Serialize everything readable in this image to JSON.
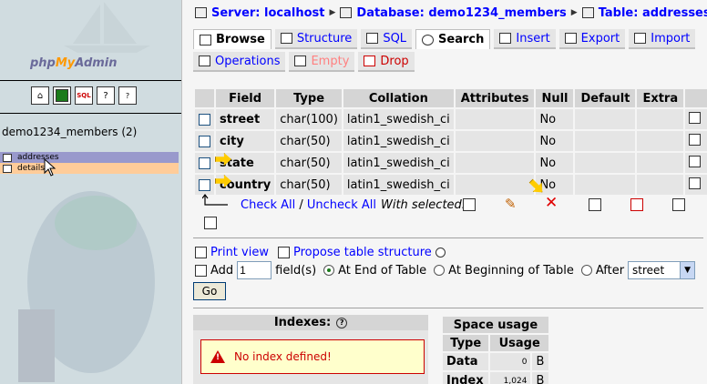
{
  "left": {
    "logo_text_1": "php",
    "logo_text_2": "My",
    "logo_text_3": "Admin",
    "nav_icons": [
      "home-icon",
      "query-window-icon",
      "sql-icon",
      "docs-icon",
      "help-icon"
    ],
    "database": "demo1234_members (2)",
    "tables": [
      "addresses",
      "details"
    ]
  },
  "breadcrumb": {
    "server": "Server: localhost",
    "database": "Database: demo1234_members",
    "table": "Table: addresses"
  },
  "tabs_row1": [
    {
      "label": "Browse",
      "icon": "browse-icon"
    },
    {
      "label": "Structure",
      "icon": "structure-icon"
    },
    {
      "label": "SQL",
      "icon": "sql-icon"
    },
    {
      "label": "Search",
      "icon": "search-icon"
    },
    {
      "label": "Insert",
      "icon": "insert-icon"
    },
    {
      "label": "Export",
      "icon": "export-icon"
    },
    {
      "label": "Import",
      "icon": "import-icon"
    }
  ],
  "tabs_row2": [
    {
      "label": "Operations",
      "icon": "operations-icon"
    },
    {
      "label": "Empty",
      "icon": "empty-icon"
    },
    {
      "label": "Drop",
      "icon": "drop-icon"
    }
  ],
  "structure": {
    "headers": [
      "Field",
      "Type",
      "Collation",
      "Attributes",
      "Null",
      "Default",
      "Extra"
    ],
    "rows": [
      {
        "field": "street",
        "type": "char(100)",
        "collation": "latin1_swedish_ci",
        "attributes": "",
        "null": "No",
        "default": "",
        "extra": ""
      },
      {
        "field": "city",
        "type": "char(50)",
        "collation": "latin1_swedish_ci",
        "attributes": "",
        "null": "No",
        "default": "",
        "extra": ""
      },
      {
        "field": "state",
        "type": "char(50)",
        "collation": "latin1_swedish_ci",
        "attributes": "",
        "null": "No",
        "default": "",
        "extra": ""
      },
      {
        "field": "country",
        "type": "char(50)",
        "collation": "latin1_swedish_ci",
        "attributes": "",
        "null": "No",
        "default": "",
        "extra": ""
      }
    ]
  },
  "check_all": "Check All",
  "uncheck_all": "Uncheck All",
  "with_selected": "With selected:",
  "print_view": "Print view",
  "propose_structure": "Propose table structure",
  "add_field": {
    "label": "Add",
    "value": "1",
    "suffix": "field(s)",
    "at_end": "At End of Table",
    "at_beginning": "At Beginning of Table",
    "after": "After",
    "after_select": "street"
  },
  "go": "Go",
  "indexes": {
    "title": "Indexes:",
    "message": "No index defined!"
  },
  "space_usage": {
    "title": "Space usage",
    "headers": [
      "Type",
      "Usage"
    ],
    "rows": [
      {
        "type": "Data",
        "usage": "0",
        "unit": "B"
      },
      {
        "type": "Index",
        "usage": "1,024",
        "unit": "B"
      }
    ]
  },
  "colors": {
    "left_bg": "#d0dce0",
    "link": "#0000ff",
    "selected_table": "#9999cc",
    "hover_table": "#ffcc99"
  }
}
